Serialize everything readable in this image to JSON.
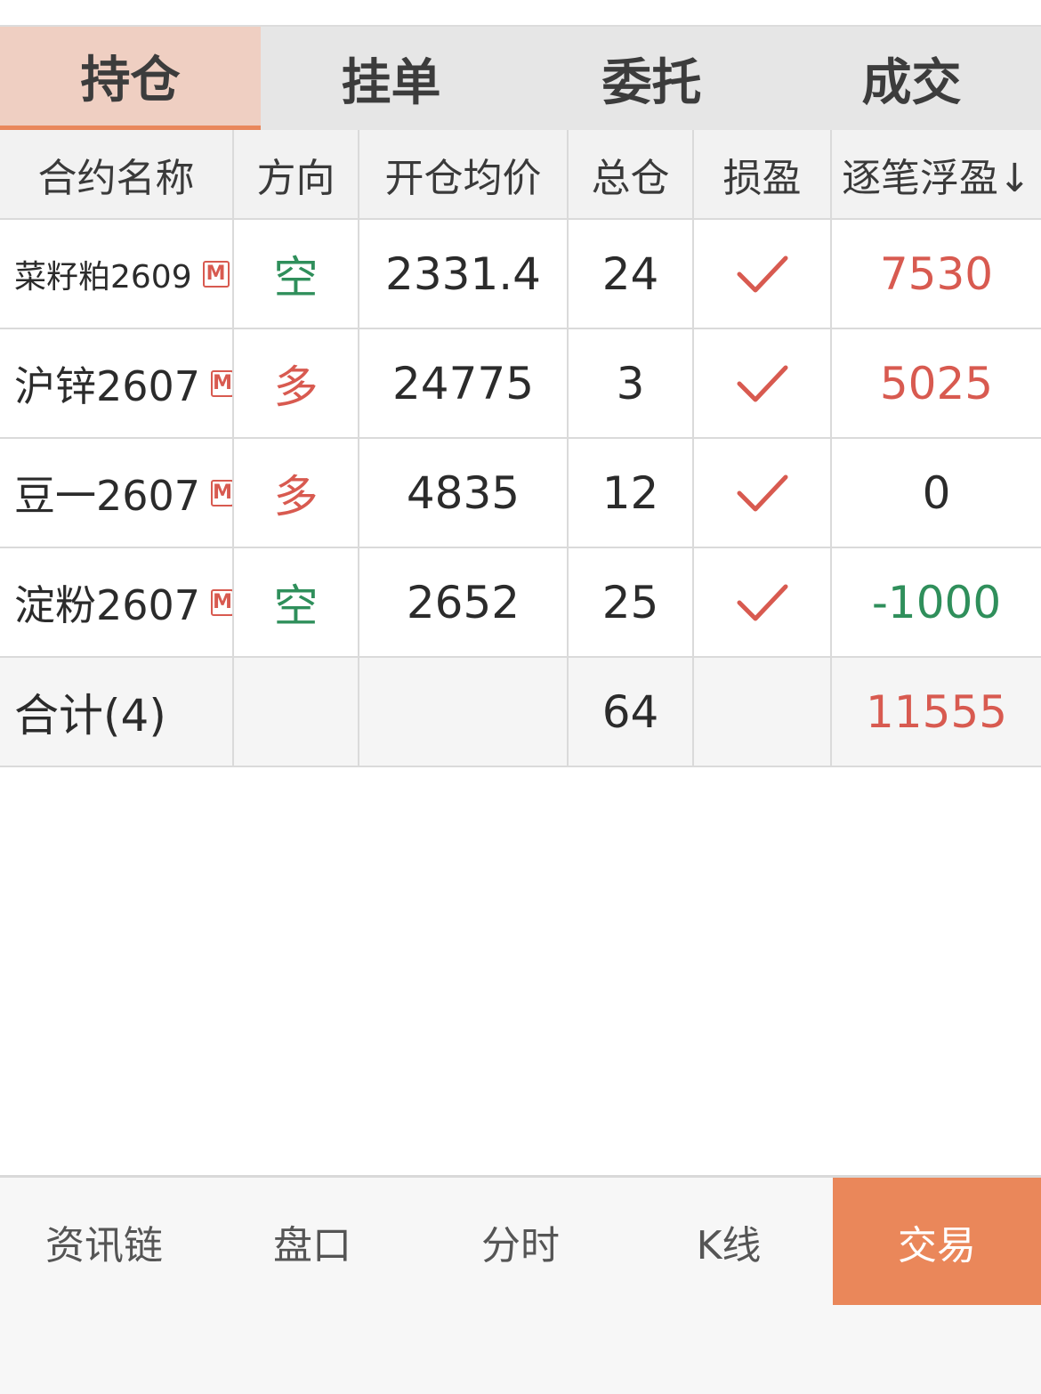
{
  "tabs": [
    {
      "label": "持仓"
    },
    {
      "label": "挂单"
    },
    {
      "label": "委托"
    },
    {
      "label": "成交"
    }
  ],
  "active_tab": "持仓",
  "table": {
    "headers": [
      "合约名称",
      "方向",
      "开仓均价",
      "总仓",
      "损盈",
      "逐笔浮盈↓"
    ],
    "rows": [
      {
        "name": "菜籽粕2609",
        "badge": "M",
        "direction": "空",
        "avg_price": "2331.4",
        "total": "24",
        "stop_loss": "check-icon",
        "pnl": "7530"
      },
      {
        "name": "沪锌2607",
        "badge": "M",
        "direction": "多",
        "avg_price": "24775",
        "total": "3",
        "stop_loss": "check-icon",
        "pnl": "5025"
      },
      {
        "name": "豆一2607",
        "badge": "M",
        "direction": "多",
        "avg_price": "4835",
        "total": "12",
        "stop_loss": "check-icon",
        "pnl": "0"
      },
      {
        "name": "淀粉2607",
        "badge": "M",
        "direction": "空",
        "avg_price": "2652",
        "total": "25",
        "stop_loss": "check-icon",
        "pnl": "-1000"
      }
    ],
    "total_row": {
      "label": "合计(4)",
      "total": "64",
      "pnl": "11555"
    }
  },
  "bottom_nav": [
    {
      "label": "资讯链"
    },
    {
      "label": "盘口"
    },
    {
      "label": "分时"
    },
    {
      "label": "K线"
    },
    {
      "label": "交易"
    }
  ],
  "colors": {
    "accent": "#ea875a",
    "active_tab_bg": "#efcfc2",
    "profit": "#d85a50",
    "loss": "#2f8f5b"
  }
}
